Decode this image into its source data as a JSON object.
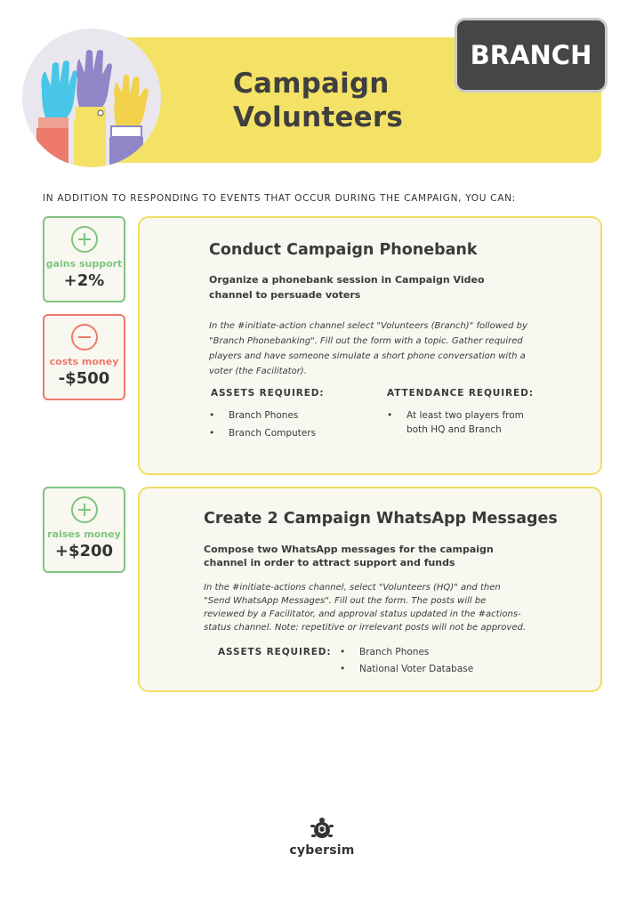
{
  "header": {
    "title_line1": "Campaign",
    "title_line2": "Volunteers",
    "tag": "BRANCH"
  },
  "intro": "IN ADDITION TO RESPONDING TO EVENTS THAT OCCUR DURING THE CAMPAIGN, YOU CAN:",
  "colors": {
    "yellow": "#f3e265",
    "green": "#7fc47f",
    "red": "#ee7a6c",
    "dark": "#464646"
  },
  "actions": [
    {
      "title": "Conduct Campaign Phonebank",
      "description": "Organize a phonebank session in Campaign Video channel to persuade voters",
      "instructions": "In the #initiate-action channel select \"Volunteers (Branch)\" followed by \"Branch Phonebanking\". Fill out the form with a topic. Gather required players and have someone simulate a short phone conversation with a voter (the Facilitator).",
      "assets_heading": "ASSETS REQUIRED:",
      "assets": [
        "Branch Phones",
        "Branch Computers"
      ],
      "attendance_heading": "ATTENDANCE REQUIRED:",
      "attendance": [
        "At least two players from both HQ and Branch"
      ],
      "effects": [
        {
          "icon": "plus-icon",
          "label": "gains support",
          "value": "+2%"
        },
        {
          "icon": "minus-icon",
          "label": "costs money",
          "value": "-$500"
        }
      ]
    },
    {
      "title": "Create 2 Campaign WhatsApp Messages",
      "description": "Compose two WhatsApp messages for the campaign channel in order to attract support and funds",
      "instructions": "In the #initiate-actions channel, select \"Volunteers (HQ)\" and then \"Send WhatsApp Messages\". Fill out the form. The posts will be reviewed by a Facilitator, and approval status updated in the #actions-status channel. Note: repetitive or irrelevant posts will not be approved.",
      "assets_heading": "ASSETS REQUIRED:",
      "assets": [
        "Branch Phones",
        "National Voter Database"
      ],
      "effects": [
        {
          "icon": "plus-icon",
          "label": "raises money",
          "value": "+$200"
        }
      ]
    }
  ],
  "footer": {
    "logo_text": "cybersim",
    "logo_icon": "turtle-icon"
  }
}
